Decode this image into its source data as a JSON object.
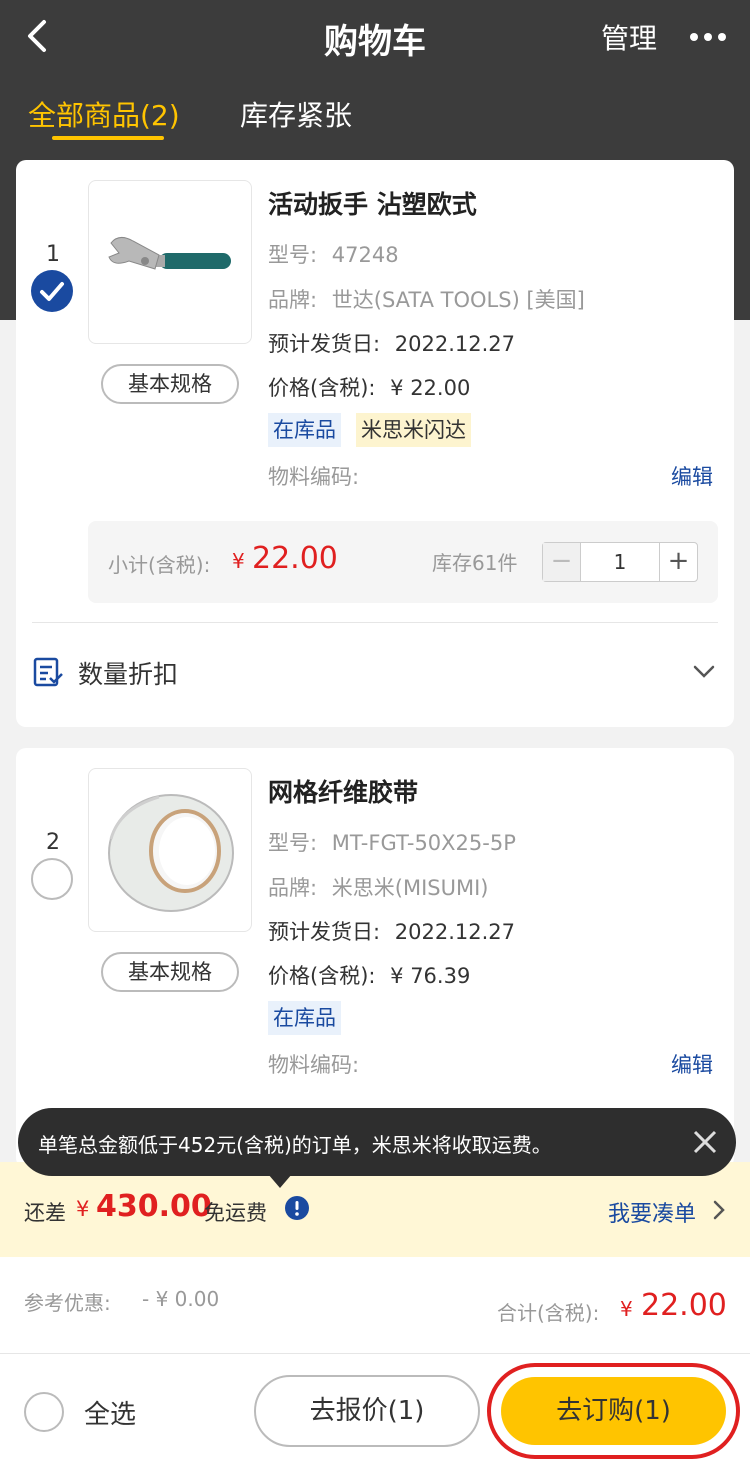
{
  "nav": {
    "title": "购物车",
    "manage": "管理"
  },
  "tabs": [
    {
      "label": "全部商品(2)",
      "active": true
    },
    {
      "label": "库存紧张",
      "active": false
    }
  ],
  "items": [
    {
      "index": "1",
      "selected": true,
      "name": "活动扳手 沾塑欧式",
      "model_label": "型号:",
      "model": "47248",
      "brand_label": "品牌:",
      "brand": "世达(SATA TOOLS) [美国]",
      "ship_label": "预计发货日:",
      "ship_date": "2022.12.27",
      "price_label": "价格(含税):",
      "price": "¥ 22.00",
      "tags": [
        "在库品",
        "米思米闪达"
      ],
      "material_label": "物料编码:",
      "edit": "编辑",
      "spec_button": "基本规格",
      "subtotal_label": "小计(含税):",
      "subtotal_currency": "¥",
      "subtotal": "22.00",
      "stock": "库存61件",
      "quantity": "1",
      "discount_label": "数量折扣"
    },
    {
      "index": "2",
      "selected": false,
      "name": "网格纤维胶带",
      "model_label": "型号:",
      "model": "MT-FGT-50X25-5P",
      "brand_label": "品牌:",
      "brand": "米思米(MISUMI)",
      "ship_label": "预计发货日:",
      "ship_date": "2022.12.27",
      "price_label": "价格(含税):",
      "price": "¥ 76.39",
      "tags": [
        "在库品"
      ],
      "material_label": "物料编码:",
      "edit": "编辑",
      "spec_button": "基本规格"
    }
  ],
  "tooltip": {
    "text": "单笔总金额低于452元(含税)的订单，米思米将收取运费。"
  },
  "shipping": {
    "prefix": "还差",
    "currency": "¥",
    "amount": "430.00",
    "suffix": "免运费",
    "link": "我要凑单"
  },
  "summary": {
    "ref_label": "参考优惠:",
    "ref_value": "- ¥ 0.00",
    "total_label": "合计(含税):",
    "total_currency": "¥",
    "total_value": "22.00"
  },
  "bottom": {
    "select_all": "全选",
    "quote_button": "去报价(1)",
    "order_button": "去订购(1)"
  },
  "colors": {
    "accent": "#ffc400",
    "brand_blue": "#1a4aa0",
    "price_red": "#e02020",
    "header_bg": "#3c3c3c"
  }
}
